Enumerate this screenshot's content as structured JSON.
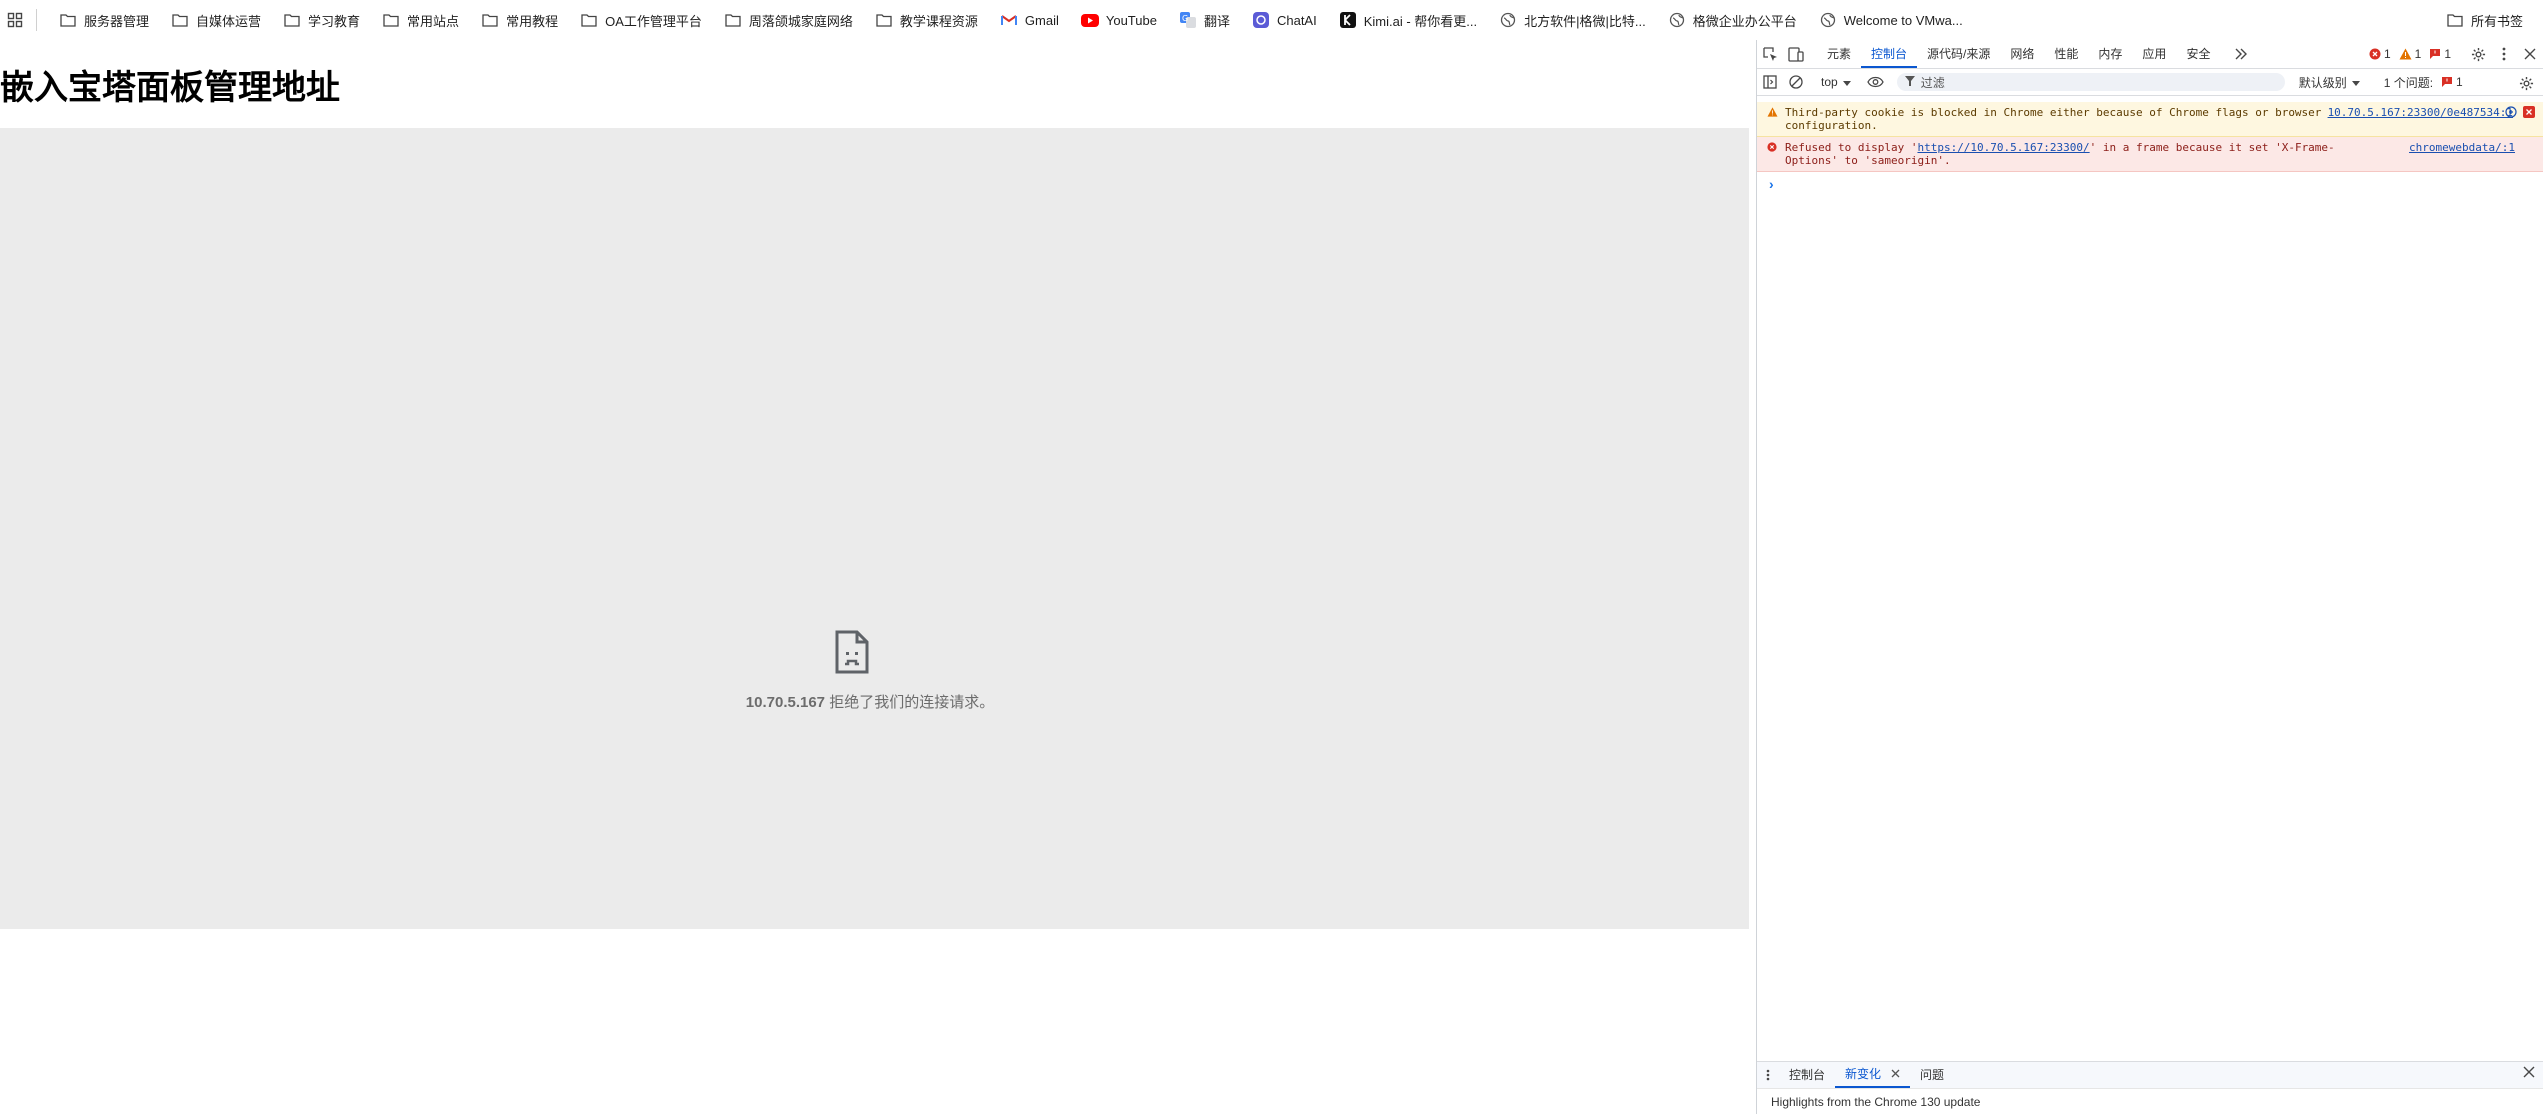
{
  "bookmarks": {
    "items": [
      {
        "label": "服务器管理",
        "icon": "folder-icon"
      },
      {
        "label": "自媒体运营",
        "icon": "folder-icon"
      },
      {
        "label": "学习教育",
        "icon": "folder-icon"
      },
      {
        "label": "常用站点",
        "icon": "folder-icon"
      },
      {
        "label": "常用教程",
        "icon": "folder-icon"
      },
      {
        "label": "OA工作管理平台",
        "icon": "folder-icon"
      },
      {
        "label": "周落颌城家庭网络",
        "icon": "folder-icon"
      },
      {
        "label": "教学课程资源",
        "icon": "folder-icon"
      },
      {
        "label": "Gmail",
        "icon": "gmail-icon"
      },
      {
        "label": "YouTube",
        "icon": "youtube-icon"
      },
      {
        "label": "翻译",
        "icon": "translate-icon"
      },
      {
        "label": "ChatAI",
        "icon": "chatai-icon"
      },
      {
        "label": "Kimi.ai - 帮你看更...",
        "icon": "kimi-icon"
      },
      {
        "label": "北方软件|格微|比特...",
        "icon": "globe-icon"
      },
      {
        "label": "格微企业办公平台",
        "icon": "globe-icon"
      },
      {
        "label": "Welcome to VMwa...",
        "icon": "globe-icon"
      }
    ],
    "all_bookmarks": "所有书签"
  },
  "page": {
    "title": "嵌入宝塔面板管理地址",
    "error_host": "10.70.5.167",
    "error_text": " 拒绝了我们的连接请求。"
  },
  "devtools": {
    "tabs": [
      "元素",
      "控制台",
      "源代码/来源",
      "网络",
      "性能",
      "内存",
      "应用",
      "安全"
    ],
    "active_tab": "控制台",
    "counts": {
      "errors": "1",
      "warnings": "1",
      "issues": "1"
    },
    "toolbar": {
      "context": "top",
      "filter_placeholder": "过滤",
      "level": "默认级别",
      "issues_label": "1 个问题:",
      "issues_count": "1"
    },
    "messages": [
      {
        "type": "warning",
        "text": "Third-party cookie is blocked in Chrome either because of Chrome flags or browser configuration.",
        "source": "10.70.5.167:23300/0e487534:1"
      },
      {
        "type": "error",
        "text_before": "Refused to display '",
        "link": "https://10.70.5.167:23300/",
        "text_after": "' in a frame because it set 'X-Frame-Options' to 'sameorigin'.",
        "source": "chromewebdata/:1"
      }
    ],
    "drawer": {
      "tabs": [
        "控制台",
        "新变化",
        "问题"
      ],
      "active_tab": "新变化",
      "body": "Highlights from the Chrome 130 update"
    }
  },
  "colors": {
    "accent": "#0b57d0",
    "error": "#d93025",
    "warning": "#e37400",
    "iframe_bg": "#ebebeb"
  }
}
